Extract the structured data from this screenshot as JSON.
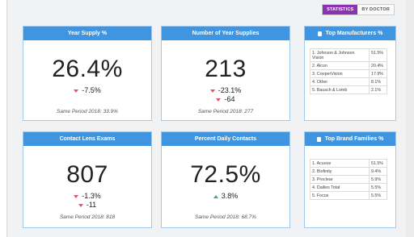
{
  "toggle": {
    "statistics": "STATISTICS",
    "by_doctor": "BY DOCTOR"
  },
  "cards": {
    "year_supply": {
      "title": "Year Supply %",
      "value": "26.4%",
      "delta": "-7.5%",
      "same": "Same Period 2018: 33.9%"
    },
    "num_year_supplies": {
      "title": "Number of Year Supplies",
      "value": "213",
      "delta": "-23.1%",
      "delta2": "-64",
      "same": "Same Period 2018: 277"
    },
    "contact_lens_exams": {
      "title": "Contact Lens Exams",
      "value": "807",
      "delta": "-1.3%",
      "delta2": "-11",
      "same": "Same Period 2018: 818"
    },
    "percent_daily": {
      "title": "Percent Daily Contacts",
      "value": "72.5%",
      "delta": "3.8%",
      "same": "Same Period 2018: 68.7%"
    }
  },
  "manufacturers": {
    "title": "Top Manufacturers %",
    "rows": [
      {
        "name": "1. Johnson & Johnson Vision",
        "pct": "51.5%"
      },
      {
        "name": "2. Alcon",
        "pct": "20.4%"
      },
      {
        "name": "3. CooperVision",
        "pct": "17.9%"
      },
      {
        "name": "4. Other",
        "pct": "8.1%"
      },
      {
        "name": "5. Bausch & Lomb",
        "pct": "2.1%"
      }
    ]
  },
  "brands": {
    "title": "Top Brand Families %",
    "rows": [
      {
        "name": "1. Acuvue",
        "pct": "51.5%"
      },
      {
        "name": "2. Biofinity",
        "pct": "9.4%"
      },
      {
        "name": "3. Proclear",
        "pct": "5.9%"
      },
      {
        "name": "4. Dailies Total",
        "pct": "5.5%"
      },
      {
        "name": "5. Focus",
        "pct": "5.5%"
      }
    ]
  },
  "colors": {
    "header_blue": "#3f95e0",
    "active_purple": "#8c33b3",
    "down_red": "#e0556a",
    "up_green": "#2fae8a"
  }
}
